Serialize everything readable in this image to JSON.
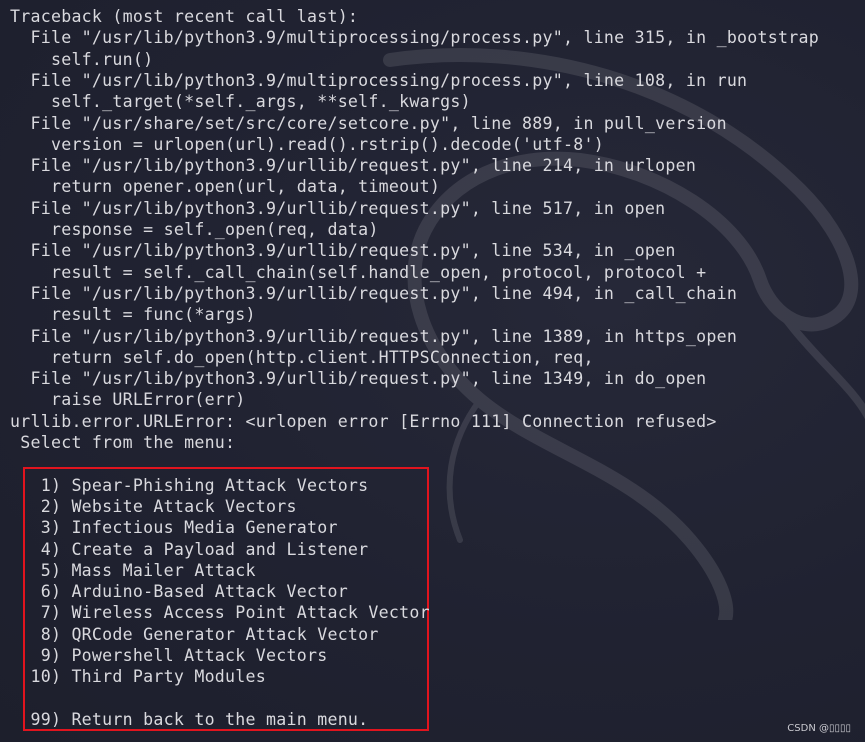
{
  "terminal": {
    "traceback_lines": [
      "Traceback (most recent call last):",
      "  File \"/usr/lib/python3.9/multiprocessing/process.py\", line 315, in _bootstrap",
      "    self.run()",
      "  File \"/usr/lib/python3.9/multiprocessing/process.py\", line 108, in run",
      "    self._target(*self._args, **self._kwargs)",
      "  File \"/usr/share/set/src/core/setcore.py\", line 889, in pull_version",
      "    version = urlopen(url).read().rstrip().decode('utf-8')",
      "  File \"/usr/lib/python3.9/urllib/request.py\", line 214, in urlopen",
      "    return opener.open(url, data, timeout)",
      "  File \"/usr/lib/python3.9/urllib/request.py\", line 517, in open",
      "    response = self._open(req, data)",
      "  File \"/usr/lib/python3.9/urllib/request.py\", line 534, in _open",
      "    result = self._call_chain(self.handle_open, protocol, protocol +",
      "  File \"/usr/lib/python3.9/urllib/request.py\", line 494, in _call_chain",
      "    result = func(*args)",
      "  File \"/usr/lib/python3.9/urllib/request.py\", line 1389, in https_open",
      "    return self.do_open(http.client.HTTPSConnection, req,",
      "  File \"/usr/lib/python3.9/urllib/request.py\", line 1349, in do_open",
      "    raise URLError(err)",
      "urllib.error.URLError: <urlopen error [Errno 111] Connection refused>"
    ],
    "menu_prompt": " Select from the menu:",
    "menu_items": [
      "   1) Spear-Phishing Attack Vectors",
      "   2) Website Attack Vectors",
      "   3) Infectious Media Generator",
      "   4) Create a Payload and Listener",
      "   5) Mass Mailer Attack",
      "   6) Arduino-Based Attack Vector",
      "   7) Wireless Access Point Attack Vector",
      "   8) QRCode Generator Attack Vector",
      "   9) Powershell Attack Vectors",
      "  10) Third Party Modules"
    ],
    "return_item": "  99) Return back to the main menu."
  },
  "credit": "CSDN @▯▯▯▯",
  "colors": {
    "background": "#212332",
    "text": "#d9d9de",
    "highlight_box": "#e1141e"
  },
  "icons": {
    "watermark": "kali-dragon-icon"
  }
}
